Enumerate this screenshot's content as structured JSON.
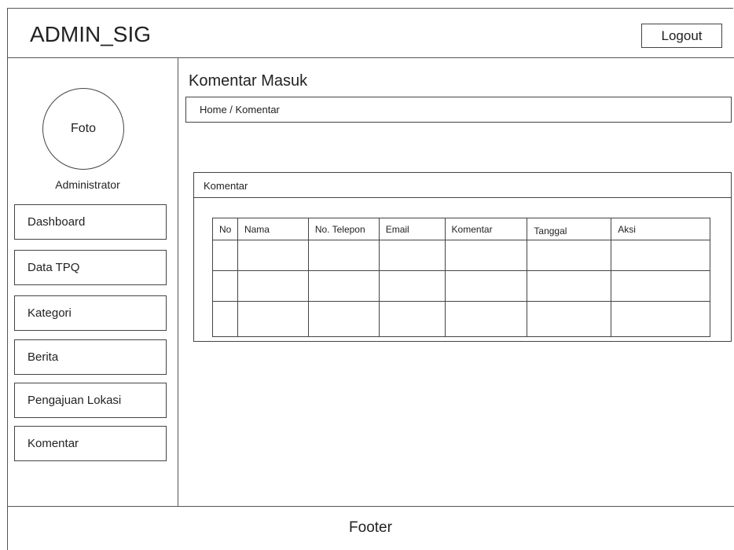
{
  "header": {
    "app_title": "ADMIN_SIG",
    "logout_label": "Logout"
  },
  "sidebar": {
    "avatar_label": "Foto",
    "role": "Administrator",
    "items": [
      {
        "label": "Dashboard"
      },
      {
        "label": "Data TPQ"
      },
      {
        "label": "Kategori"
      },
      {
        "label": "Berita"
      },
      {
        "label": "Pengajuan Lokasi"
      },
      {
        "label": "Komentar"
      }
    ]
  },
  "main": {
    "page_title": "Komentar Masuk",
    "breadcrumb": "Home / Komentar",
    "panel": {
      "title": "Komentar",
      "columns": [
        "No",
        "Nama",
        "No. Telepon",
        "Email",
        "Komentar",
        "Tanggal",
        "Aksi"
      ]
    }
  },
  "footer": {
    "label": "Footer"
  }
}
